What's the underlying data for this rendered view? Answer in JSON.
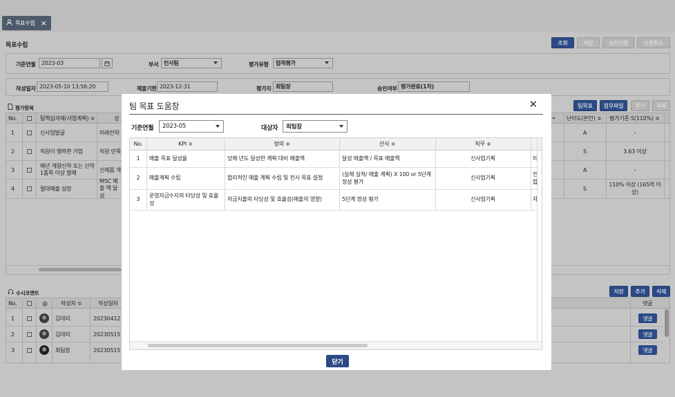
{
  "tab": {
    "label": "목표수립",
    "close": "×"
  },
  "page_title": "목표수립",
  "top_buttons": [
    "조회",
    "저장",
    "승인신청",
    "신청취소"
  ],
  "filters": {
    "base_month_label": "기준연월",
    "base_month": "2023-03",
    "dept_label": "부서",
    "dept": "인사팀",
    "eval_type_label": "평가유형",
    "eval_type": "업적평가"
  },
  "info": {
    "created_label": "작성일자",
    "created": "2023-05-10 13:56:20",
    "deadline_label": "제출기한",
    "deadline": "2023-12-31",
    "evaluator_label": "평가자",
    "evaluator": "최팀장",
    "approval_label": "승인여부",
    "approval": "평가완료(1차)"
  },
  "eval_section": {
    "title": "평가항목",
    "buttons": [
      "팀목표",
      "첨부파일",
      "추가",
      "삭제"
    ],
    "headers": {
      "no": "No.",
      "task": "팀핵심과제(사업계획) ≑",
      "cut": "성",
      "diff": "난이도(본인) ≑",
      "std": "평가기준 S(110%) ≑"
    },
    "rows": [
      {
        "no": "1",
        "task": "신사업발굴",
        "col2": "미래전략",
        "diff": "A",
        "std": "-"
      },
      {
        "no": "2",
        "task": "직원이 행복한 기업",
        "col2": "직원 만족",
        "diff": "S",
        "std": "3.63 이상"
      },
      {
        "no": "3",
        "task": "매년 개량신약 또는 신약 1품목 이상 발매",
        "col2": "신제품 개",
        "diff": "A",
        "std": "-"
      },
      {
        "no": "4",
        "task": "절대매출 성장",
        "col2": "MSC 매출 액 달성",
        "diff": "S",
        "std": "110% 이상 (165억 이상)"
      }
    ]
  },
  "comment_section": {
    "title": "수시코멘트",
    "buttons": [
      "저장",
      "추가",
      "삭제"
    ],
    "headers": {
      "no": "No.",
      "at": "@",
      "writer": "작성자 ≑",
      "date": "작성일자",
      "reply": "댓글"
    },
    "rows": [
      {
        "no": "1",
        "writer": "김대리",
        "date": "20230412",
        "reply": "댓글"
      },
      {
        "no": "2",
        "writer": "김대리",
        "date": "20230515",
        "reply": "댓글"
      },
      {
        "no": "3",
        "writer": "최팀장",
        "date": "20230515",
        "reply": "댓글"
      }
    ]
  },
  "modal": {
    "title": "팀 목표 도움창",
    "close": "✕",
    "base_month_label": "기준연월",
    "base_month": "2023-05",
    "target_label": "대상자",
    "target": "최팀장",
    "headers": {
      "no": "No.",
      "kpi": "KPI ≑",
      "def": "정의 ≑",
      "formula": "산식 ≑",
      "job": "직무 ≑"
    },
    "rows": [
      {
        "no": "1",
        "kpi": "매출 목표 달성율",
        "def": "당해 년도 달성한 계획 대비 매출액",
        "formula": "달성 매출액 / 목표 매출액",
        "job": "신사업기획",
        "cut": "미"
      },
      {
        "no": "2",
        "kpi": "매출계획 수립",
        "def": "합리적인 매출 계획 수립 및 전사 목표 설정",
        "formula": "(실제 실적/ 매출 계획) X 100 or 5단계 정성 평가",
        "job": "신사업기획",
        "cut": "전 합"
      },
      {
        "no": "3",
        "kpi": "운영자금수지의 타당성 및 효율성",
        "def": "자금지출의 타당성 및 효율성(매출의 영향)",
        "formula": "5단계 정성 평가",
        "job": "신사업기획",
        "cut": "자"
      }
    ],
    "close_button": "닫기"
  }
}
